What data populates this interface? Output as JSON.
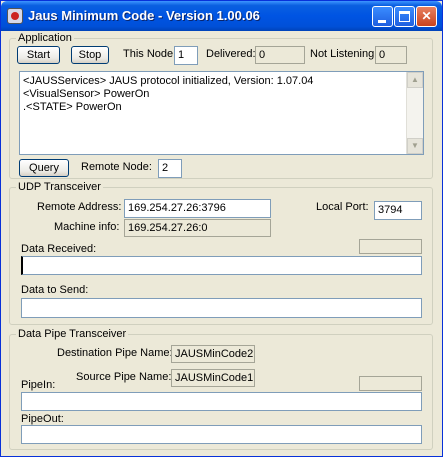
{
  "window": {
    "title": "Jaus Minimum Code - Version 1.00.06"
  },
  "application": {
    "legend": "Application",
    "start_label": "Start",
    "stop_label": "Stop",
    "this_node_label": "This Node:",
    "this_node_value": "1",
    "delivered_label": "Delivered:",
    "delivered_value": "0",
    "not_listening_label": "Not Listening:",
    "not_listening_value": "0",
    "log_lines": [
      "<JAUSServices> JAUS protocol initialized, Version: 1.07.04",
      "<VisualSensor> PowerOn",
      ".<STATE> PowerOn"
    ],
    "query_label": "Query",
    "remote_node_label": "Remote Node:",
    "remote_node_value": "2"
  },
  "udp": {
    "legend": "UDP Transceiver",
    "remote_address_label": "Remote Address:",
    "remote_address_value": "169.254.27.26:3796",
    "local_port_label": "Local Port:",
    "local_port_value": "3794",
    "machine_info_label": "Machine info:",
    "machine_info_value": "169.254.27.26:0",
    "data_received_label": "Data Received:",
    "data_received_value": "",
    "data_to_send_label": "Data to Send:",
    "data_to_send_value": ""
  },
  "pipe": {
    "legend": "Data Pipe Transceiver",
    "destination_label": "Destination Pipe Name:",
    "destination_value": "JAUSMinCode2",
    "source_label": "Source Pipe Name:",
    "source_value": "JAUSMinCode1",
    "pipein_label": "PipeIn:",
    "pipein_value": "",
    "pipeout_label": "PipeOut:",
    "pipeout_value": ""
  }
}
